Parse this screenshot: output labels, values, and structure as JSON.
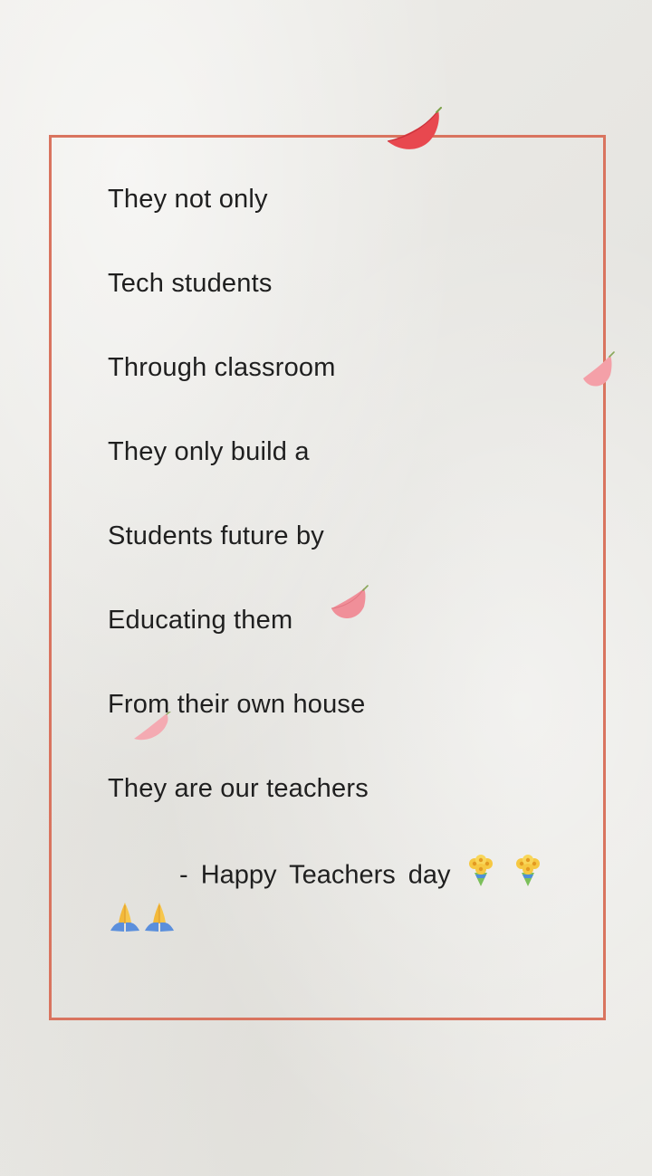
{
  "poem": {
    "lines": [
      "They not only",
      "Tech students",
      "Through classroom",
      "They only build a",
      "Students future by",
      "Educating them",
      "From their own house",
      "They are our teachers"
    ],
    "signoff_text": "- Happy Teachers day",
    "emojis": [
      "bouquet-icon",
      "bouquet-icon",
      "folded-hands-icon",
      "folded-hands-icon"
    ]
  },
  "colors": {
    "background": "#ebeae6",
    "frame_border": "#d9745f",
    "text": "#1f1f1f",
    "petal_red": "#e8484f",
    "petal_pink": "#f4a0a8"
  }
}
